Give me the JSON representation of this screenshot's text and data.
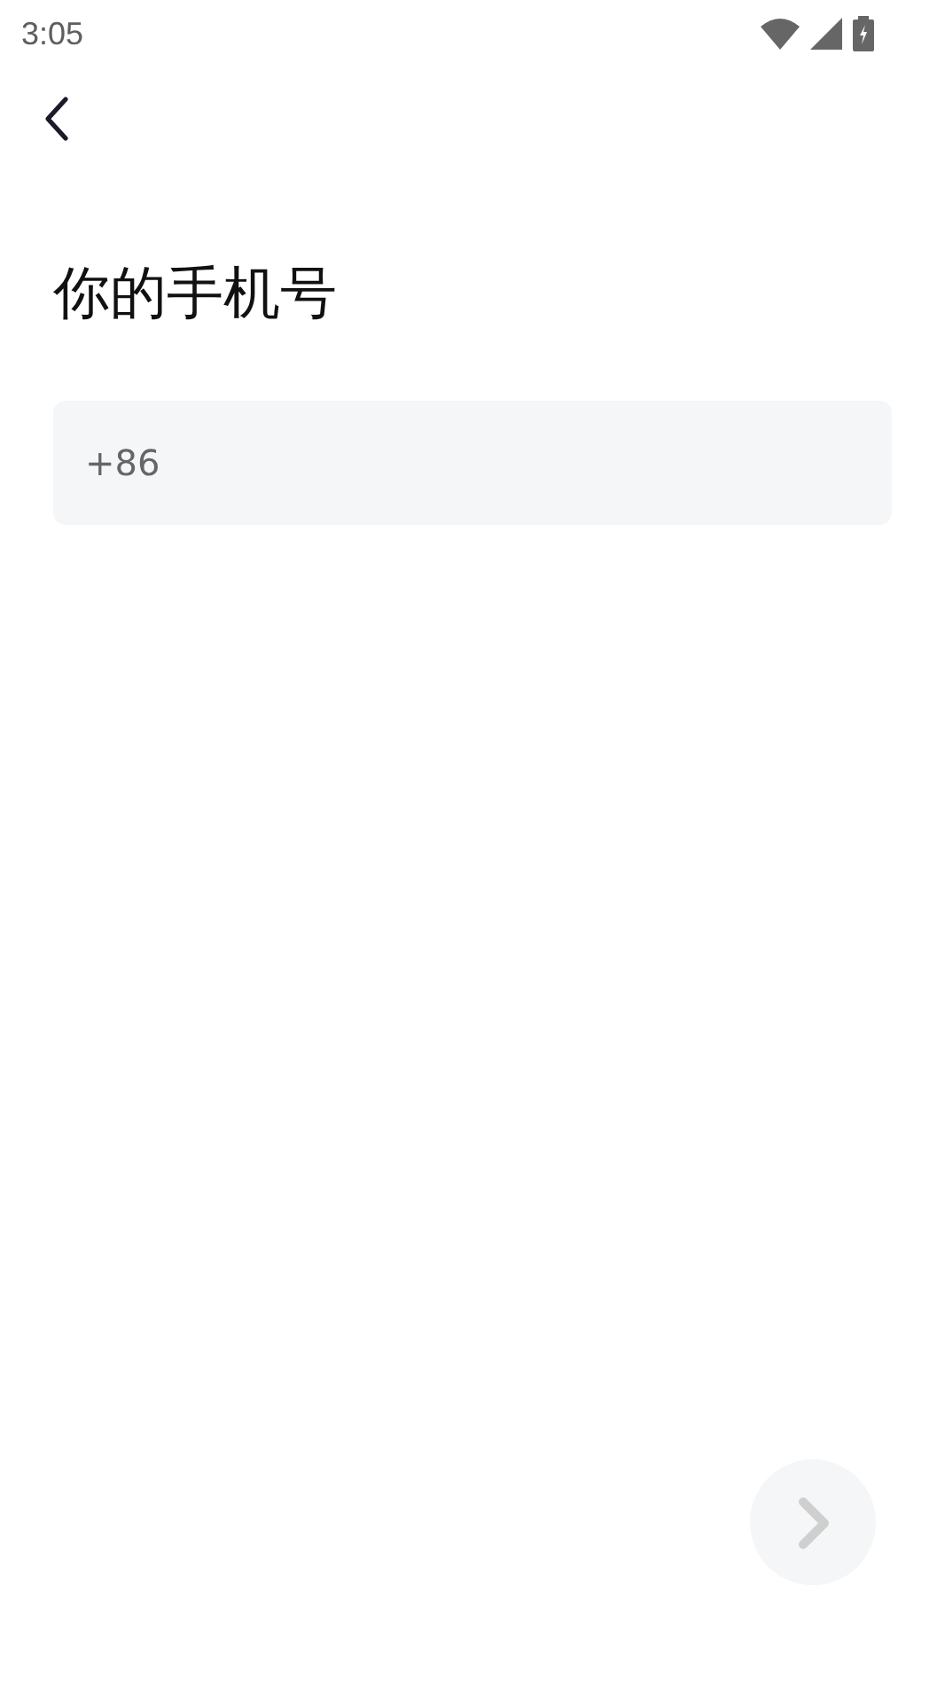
{
  "status_bar": {
    "time": "3:05"
  },
  "title": "你的手机号",
  "phone_field": {
    "country_code": "+86"
  },
  "next_button": {
    "disabled": true
  }
}
